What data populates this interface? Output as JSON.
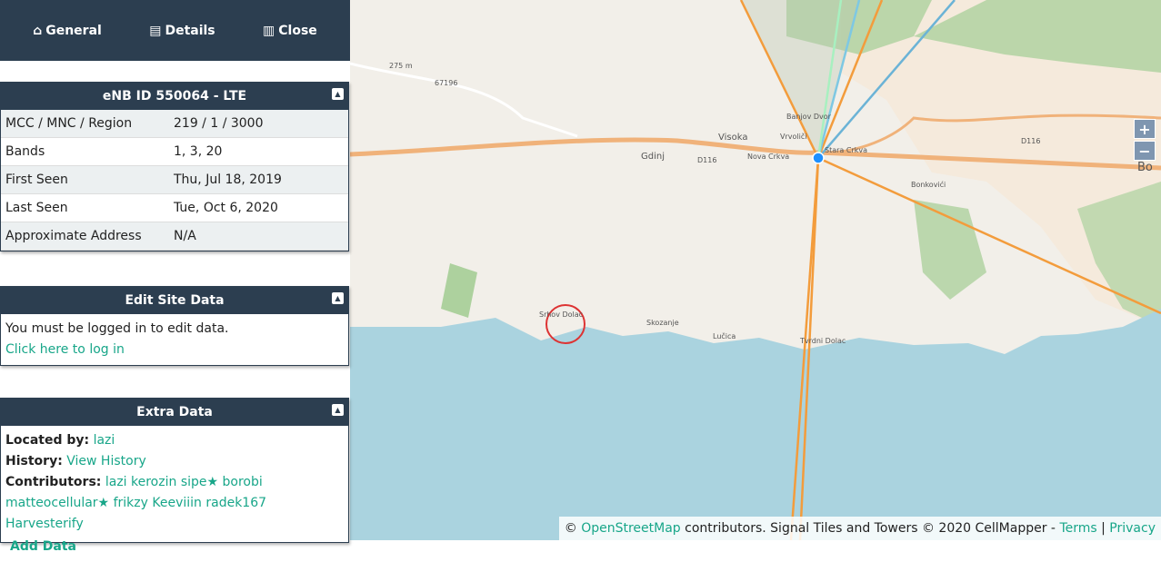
{
  "nav": {
    "general": "General",
    "details": "Details",
    "close": "Close"
  },
  "site": {
    "title": "eNB ID 550064 - LTE",
    "rows": [
      {
        "label": "MCC / MNC / Region",
        "value": "219 / 1 / 3000"
      },
      {
        "label": "Bands",
        "value": "1, 3, 20"
      },
      {
        "label": "First Seen",
        "value": "Thu, Jul 18, 2019"
      },
      {
        "label": "Last Seen",
        "value": "Tue, Oct 6, 2020"
      },
      {
        "label": "Approximate Address",
        "value": "N/A"
      }
    ]
  },
  "edit": {
    "title": "Edit Site Data",
    "message": "You must be logged in to edit data.",
    "login_link": "Click here to log in"
  },
  "extra": {
    "title": "Extra Data",
    "located_label": "Located by:",
    "located_by": "lazi",
    "history_label": "History:",
    "history_link": "View History",
    "contributors_label": "Contributors:",
    "contributors": [
      "lazi",
      "kerozin",
      "sipe★",
      "borobi",
      "matteocellular★",
      "frikzy",
      "Keeviiin",
      "radek167",
      "Harvesterify"
    ],
    "add_data": "Add Data"
  },
  "map": {
    "labels": [
      "275 m",
      "67196",
      "Visoka",
      "Banjov Dvor",
      "Vrvoliči",
      "Stara Crkva",
      "Gdinj",
      "D116",
      "Nova Crkva",
      "D116",
      "Bonkovići",
      "Srhov Dolac",
      "Skozanje",
      "Lučica",
      "Tvrdni Dolac",
      "Bo"
    ],
    "zoom_in": "+",
    "zoom_out": "−"
  },
  "attribution": {
    "copy": "©",
    "osm": "OpenStreetMap",
    "text": " contributors. Signal Tiles and Towers © 2020 CellMapper - ",
    "terms": "Terms",
    "sep": " | ",
    "privacy": "Privacy"
  },
  "colors": {
    "header": "#2c3e50",
    "link": "#18a689",
    "land": "#f2efe9",
    "sea": "#aad3df",
    "sector": "#f39c3c",
    "tower": "#1e90ff"
  }
}
